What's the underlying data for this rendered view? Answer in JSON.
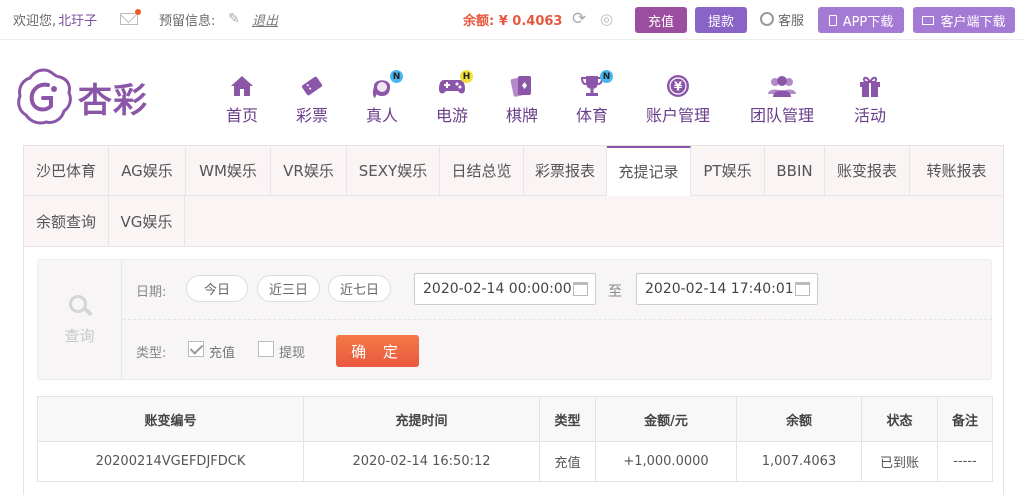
{
  "topbar": {
    "welcome": "欢迎您,",
    "username": "北玗子",
    "reserve_label": "预留信息:",
    "logout": "退出",
    "balance": "余额: ¥ 0.4063",
    "recharge": "充值",
    "withdraw": "提款",
    "service": "客服",
    "app_download": "APP下载",
    "client_download": "客户端下载"
  },
  "logo": {
    "text": "杏彩"
  },
  "nav": [
    {
      "label": "首页",
      "icon": "home-icon"
    },
    {
      "label": "彩票",
      "icon": "ticket-icon"
    },
    {
      "label": "真人",
      "icon": "live-dealer-icon",
      "badge": "N"
    },
    {
      "label": "电游",
      "icon": "gamepad-icon",
      "badge": "H"
    },
    {
      "label": "棋牌",
      "icon": "cards-icon"
    },
    {
      "label": "体育",
      "icon": "trophy-icon",
      "badge": "N"
    },
    {
      "label": "账户管理",
      "icon": "yen-coin-icon"
    },
    {
      "label": "团队管理",
      "icon": "team-icon"
    },
    {
      "label": "活动",
      "icon": "gift-icon"
    }
  ],
  "tabs": [
    "沙巴体育",
    "AG娱乐",
    "WM娱乐",
    "VR娱乐",
    "SEXY娱乐",
    "日结总览",
    "彩票报表",
    "充提记录",
    "PT娱乐",
    "BBIN",
    "账变报表",
    "转账报表",
    "余额查询",
    "VG娱乐"
  ],
  "active_tab": "充提记录",
  "query": {
    "side_label": "查询",
    "date_label": "日期:",
    "quick_ranges": [
      "今日",
      "近三日",
      "近七日"
    ],
    "start": "2020-02-14 00:00:00",
    "to_label": "至",
    "end": "2020-02-14 17:40:01",
    "type_label": "类型:",
    "types": [
      {
        "label": "充值",
        "checked": true
      },
      {
        "label": "提现",
        "checked": false
      }
    ],
    "confirm": "确 定"
  },
  "table": {
    "headers": [
      "账变编号",
      "充提时间",
      "类型",
      "金额/元",
      "余额",
      "状态",
      "备注"
    ],
    "rows": [
      [
        "20200214VGEFDJFDCK",
        "2020-02-14 16:50:12",
        "充值",
        "+1,000.0000",
        "1,007.4063",
        "已到账",
        "-----"
      ]
    ]
  },
  "colors": {
    "brand": "#8b56a8",
    "balance": "#e9573f",
    "amount_positive": "#d9302c",
    "status_ok": "#2a9a2a",
    "confirm_button": "#f06a3f"
  }
}
